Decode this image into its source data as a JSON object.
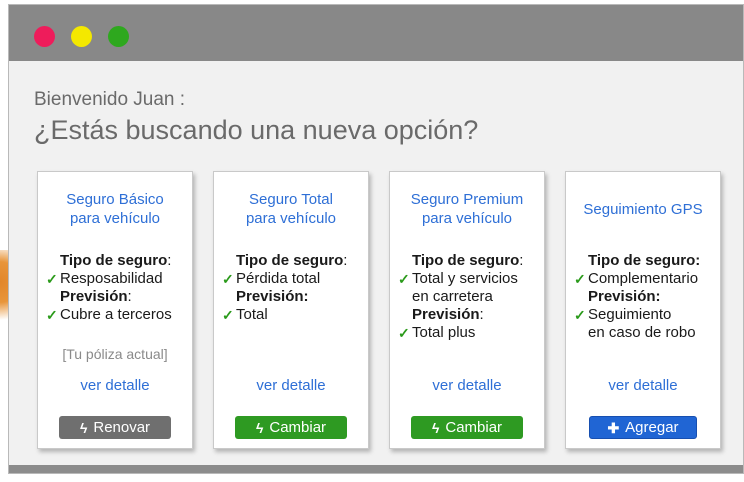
{
  "greeting": "Bienvenido Juan :",
  "headline": "¿Estás buscando una nueva opción?",
  "colors": {
    "titlebar": "#888888",
    "link": "#2e6fd6",
    "check": "#2a9a1a"
  },
  "cards": [
    {
      "title_line1": "Seguro Básico",
      "title_line2": "para vehículo",
      "tipo_label": "Tipo de seguro",
      "tipo_sep": ":",
      "tipo_value": "Resposabilidad",
      "prevision_label": "Previsión",
      "prevision_sep": ":",
      "prevision_value": "Cubre a terceros",
      "current": "[Tu póliza actual]",
      "detail": "ver detalle",
      "button": "Renovar",
      "button_icon": "bolt-icon"
    },
    {
      "title_line1": "Seguro Total",
      "title_line2": "para vehículo",
      "tipo_label": "Tipo de seguro",
      "tipo_sep": ":",
      "tipo_value": "Pérdida total",
      "prevision_label": "Previsión:",
      "prevision_value": "Total",
      "detail": "ver detalle",
      "button": "Cambiar",
      "button_icon": "bolt-icon"
    },
    {
      "title_line1": "Seguro Premium",
      "title_line2": "para vehículo",
      "tipo_label": "Tipo de seguro",
      "tipo_sep": ":",
      "tipo_value_line1": "Total y servicios",
      "tipo_value_line2": "en carretera",
      "prevision_label": "Previsión",
      "prevision_sep": ":",
      "prevision_value": "Total plus",
      "detail": "ver detalle",
      "button": "Cambiar",
      "button_icon": "bolt-icon"
    },
    {
      "title": "Seguimiento GPS",
      "tipo_label": "Tipo de seguro:",
      "tipo_value": "Complementario",
      "prevision_label": "Previsión:",
      "prevision_value_line1": "Seguimiento",
      "prevision_value_line2": "en caso de robo",
      "detail": "ver detalle",
      "button": "Agregar",
      "button_icon": "plus-icon"
    }
  ]
}
